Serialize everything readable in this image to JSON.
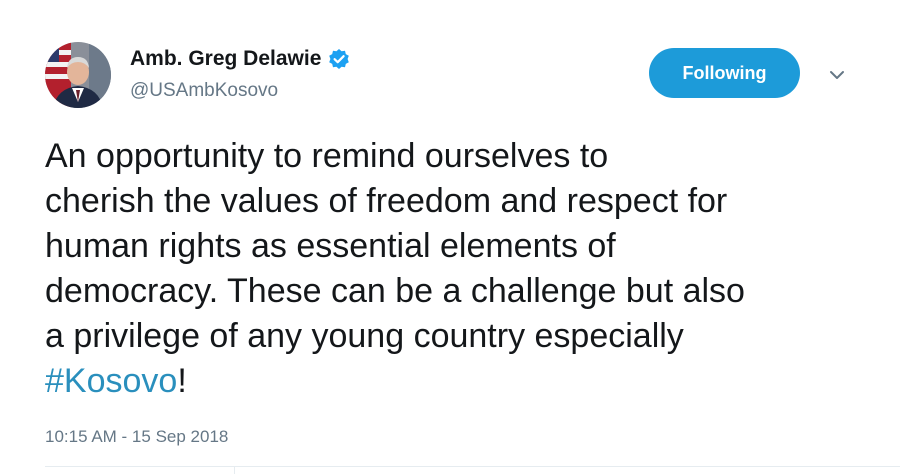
{
  "author": {
    "display_name": "Amb. Greg Delawie",
    "handle": "@USAmbKosovo",
    "verified": true
  },
  "actions": {
    "follow_label": "Following",
    "menu_icon": "chevron-down-icon"
  },
  "tweet": {
    "lines": [
      "An opportunity to remind ourselves to",
      "cherish the values of freedom and respect for",
      "human rights as essential elements of",
      "democracy. These can be a challenge but also",
      "a privilege of any young country especially"
    ],
    "hashtag": "#Kosovo",
    "trailing": "!",
    "timestamp": "10:15 AM - 15 Sep 2018"
  },
  "colors": {
    "button": "#1d9bd9",
    "hashtag": "#2a8fbd",
    "verified": "#1da1f2",
    "muted": "#657786"
  }
}
